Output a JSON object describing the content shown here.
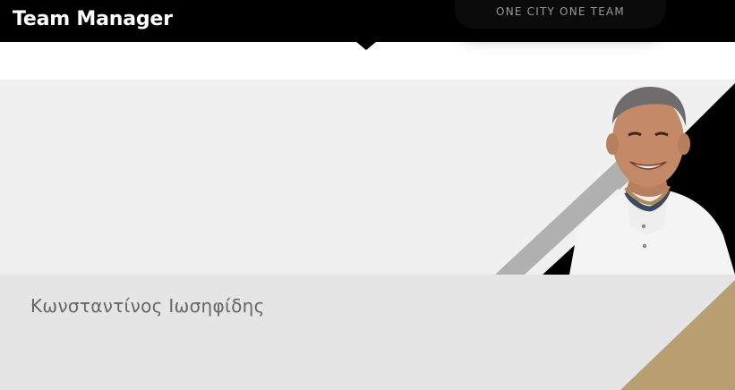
{
  "header": {
    "title": "Team Manager",
    "slogan": "ONE CITY ONE TEAM"
  },
  "profile": {
    "name": "Κωνσταντίνος Ιωσηφίδης",
    "photo_icon": "person-portrait"
  },
  "colors": {
    "header_bg": "#000000",
    "photo_bg": "#f0f0f0",
    "info_bg": "#e5e5e5",
    "stripe_gray": "#b0b0b0",
    "stripe_black": "#000000",
    "gold": "#b79f72",
    "name_text": "#666666"
  }
}
